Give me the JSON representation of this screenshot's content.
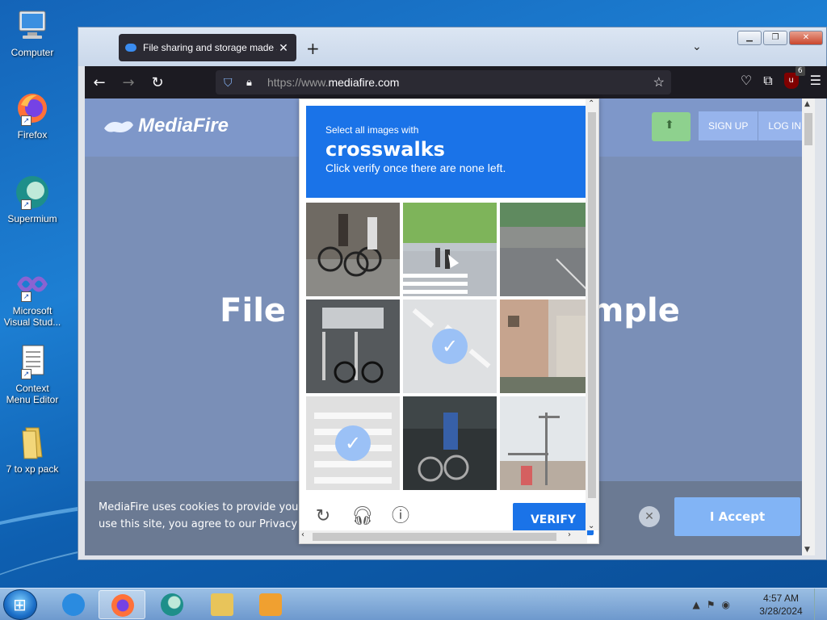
{
  "desktop": {
    "icons": [
      {
        "label": "Computer"
      },
      {
        "label": "Firefox"
      },
      {
        "label": "Supermium"
      },
      {
        "label": "Microsoft Visual Stud..."
      },
      {
        "label": "Context Menu Editor"
      },
      {
        "label": "7 to xp pack"
      }
    ]
  },
  "browser": {
    "tab_title": "File sharing and storage made s",
    "url_host": "https://www.",
    "url_main": "mediafire.com",
    "ublock_badge": "6"
  },
  "page": {
    "logo_text": "MediaFire",
    "signup_label": "SIGN UP",
    "login_label": "LOG IN",
    "hero_text": "File storage made simple",
    "cookie_text_line1": "MediaFire uses cookies to provide you",
    "cookie_text_line2": "use this site, you agree to our Privacy Po",
    "accept_label": "I Accept"
  },
  "captcha": {
    "instruction_small": "Select all images with",
    "target": "crosswalks",
    "instruction_sub": "Click verify once there are none left.",
    "verify_label": "VERIFY",
    "tiles": [
      {
        "content": "two cyclists on road",
        "selected": false
      },
      {
        "content": "street with crosswalk and trees",
        "selected": false
      },
      {
        "content": "empty road with wall",
        "selected": false
      },
      {
        "content": "bicycle parked by meters",
        "selected": false
      },
      {
        "content": "crosswalk",
        "selected": true
      },
      {
        "content": "building and alley",
        "selected": false
      },
      {
        "content": "crosswalk",
        "selected": true
      },
      {
        "content": "cyclist in shade",
        "selected": false
      },
      {
        "content": "street lamp and sky",
        "selected": false
      }
    ]
  },
  "taskbar": {
    "time": "4:57 AM",
    "date": "3/28/2024"
  }
}
